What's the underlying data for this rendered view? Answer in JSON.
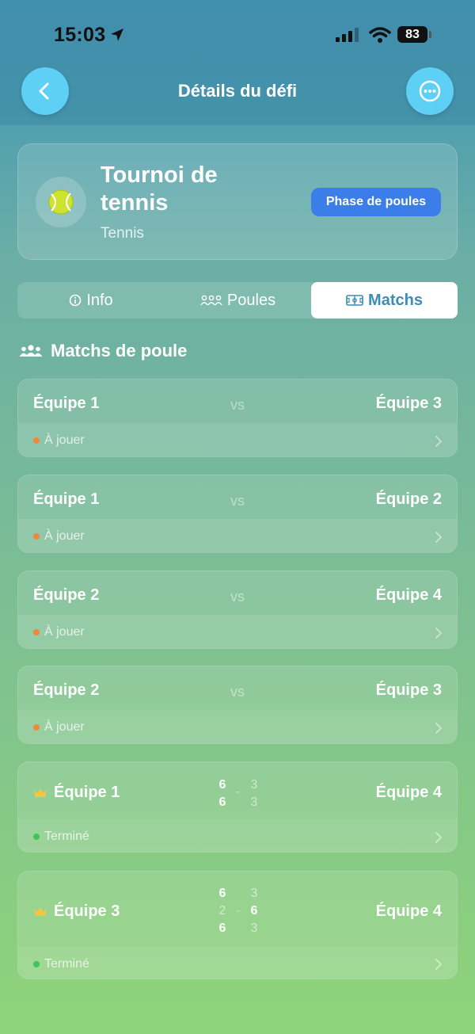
{
  "status_bar": {
    "time": "15:03",
    "battery": "83"
  },
  "nav": {
    "title": "Détails du défi",
    "back_icon": "chevron-left-icon",
    "more_icon": "more-icon",
    "button_color": "#5ed0f5"
  },
  "challenge": {
    "title": "Tournoi de tennis",
    "sport": "Tennis",
    "phase": "Phase de poules",
    "phase_color": "#3b7ee9"
  },
  "tabs": [
    {
      "label": "Info",
      "icon": "info-icon",
      "active": false
    },
    {
      "label": "Poules",
      "icon": "groups-icon",
      "active": false
    },
    {
      "label": "Matchs",
      "icon": "field-icon",
      "active": true
    }
  ],
  "section": {
    "title": "Matchs de poule",
    "icon": "people-icon"
  },
  "vs_label": "vs",
  "status_colors": {
    "to_play": "#f0883a",
    "done": "#3ec45a"
  },
  "matches": [
    {
      "team_a": "Équipe 1",
      "team_b": "Équipe 3",
      "status": "À jouer"
    },
    {
      "team_a": "Équipe 1",
      "team_b": "Équipe 2",
      "status": "À jouer"
    },
    {
      "team_a": "Équipe 2",
      "team_b": "Équipe 4",
      "status": "À jouer"
    },
    {
      "team_a": "Équipe 2",
      "team_b": "Équipe 3",
      "status": "À jouer"
    },
    {
      "team_a": "Équipe 1",
      "team_b": "Équipe 4",
      "status": "Terminé",
      "winner": "team_a",
      "sets": [
        {
          "a": "6",
          "b": "3"
        },
        {
          "a": "6",
          "b": "3"
        }
      ]
    },
    {
      "team_a": "Équipe 3",
      "team_b": "Équipe 4",
      "status": "Terminé",
      "winner": "team_a",
      "sets": [
        {
          "a": "6",
          "b": "3"
        },
        {
          "a": "2",
          "b": "6"
        },
        {
          "a": "6",
          "b": "3"
        }
      ]
    }
  ]
}
